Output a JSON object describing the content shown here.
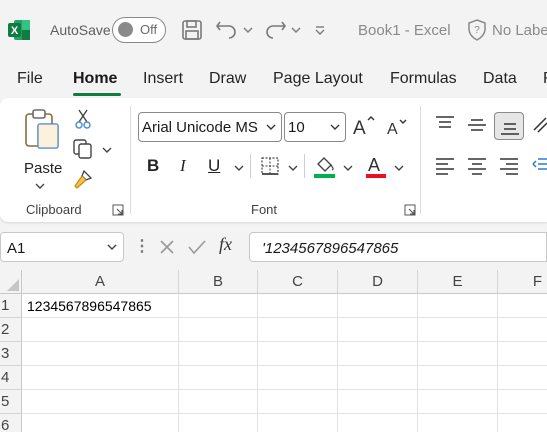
{
  "titlebar": {
    "app_icon": "excel-logo-icon",
    "autosave_label": "AutoSave",
    "autosave_state": "Off",
    "title": "Book1 - Excel",
    "sensitivity_label": "No Label"
  },
  "tabs": [
    "File",
    "Home",
    "Insert",
    "Draw",
    "Page Layout",
    "Formulas",
    "Data",
    "R"
  ],
  "active_tab": "Home",
  "ribbon": {
    "clipboard": {
      "paste_label": "Paste",
      "group_label": "Clipboard"
    },
    "font": {
      "font_name": "Arial Unicode MS",
      "font_size": "10",
      "group_label": "Font",
      "fill_color": "#00b050",
      "font_color": "#e81123"
    }
  },
  "formula_bar": {
    "name_box": "A1",
    "fx_label": "fx",
    "formula": "'1234567896547865"
  },
  "sheet": {
    "columns": [
      "A",
      "B",
      "C",
      "D",
      "E",
      "F"
    ],
    "rows": [
      "1",
      "2",
      "3",
      "4",
      "5",
      "6"
    ],
    "cells": {
      "A1": "1234567896547865"
    }
  },
  "colors": {
    "accent": "#107c41",
    "ribbon_bg": "#ffffff",
    "chrome_bg": "#f3f3f3"
  }
}
